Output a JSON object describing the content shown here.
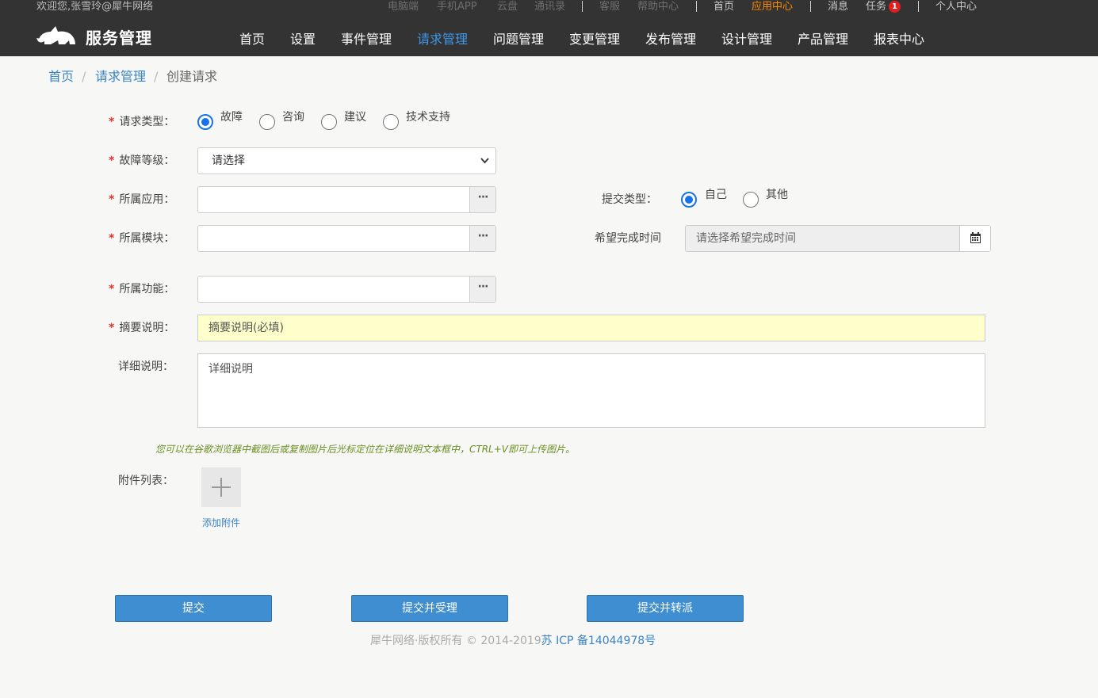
{
  "header": {
    "welcome": "欢迎您,张雪玲@犀牛网络",
    "brand": "服务管理",
    "top_links": [
      "电脑端",
      "手机APP",
      "云盘",
      "通讯录",
      "客服",
      "帮助中心",
      "首页",
      "应用中心",
      "消息",
      "任务",
      "个人中心"
    ],
    "task_badge": "1",
    "nav": [
      "首页",
      "设置",
      "事件管理",
      "请求管理",
      "问题管理",
      "变更管理",
      "发布管理",
      "设计管理",
      "产品管理",
      "报表中心"
    ],
    "active_nav": "请求管理",
    "accent_color": "#ff8a00",
    "nav_active_color": "#3f97e8"
  },
  "breadcrumb": {
    "home": "首页",
    "section": "请求管理",
    "current": "创建请求",
    "sep": "/"
  },
  "form": {
    "request_type": {
      "label": "请求类型：",
      "options": [
        "故障",
        "咨询",
        "建议",
        "技术支持"
      ],
      "selected": "故障"
    },
    "fault_level": {
      "label": "故障等级：",
      "value": "请选择"
    },
    "app": {
      "label": "所属应用：",
      "value": ""
    },
    "module": {
      "label": "所属模块：",
      "value": ""
    },
    "function": {
      "label": "所属功能：",
      "value": ""
    },
    "submit_type": {
      "label": "提交类型：",
      "options": [
        "自己",
        "其他"
      ],
      "selected": "自己"
    },
    "expected_time": {
      "label": "希望完成时间",
      "placeholder": "请选择希望完成时间"
    },
    "summary": {
      "label": "摘要说明：",
      "placeholder": "摘要说明(必填)"
    },
    "detail": {
      "label": "详细说明：",
      "placeholder": "详细说明"
    },
    "tip": "您可以在谷歌浏览器中截图后或复制图片后光标定位在详细说明文本框中，CTRL+V即可上传图片。",
    "attachments": {
      "label": "附件列表：",
      "add_label": "添加附件"
    },
    "required_mark": "*"
  },
  "buttons": {
    "submit": "提交",
    "submit_accept": "提交并受理",
    "submit_transfer": "提交并转派",
    "color": "#3e8ed1"
  },
  "footer": {
    "text": "犀牛网络·版权所有 © 2014-2019",
    "icp": "苏 ICP 备14044978号"
  }
}
